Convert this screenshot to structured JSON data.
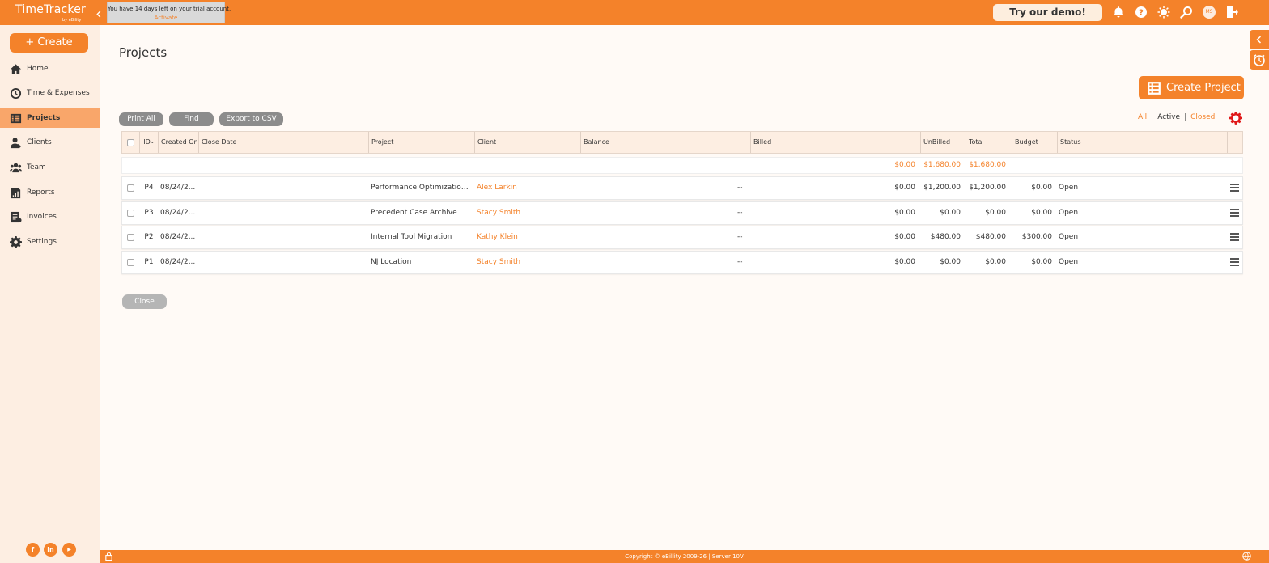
{
  "app": {
    "logo_name": "TimeTracker",
    "logo_by": "by eBility",
    "trial_message": "You have 14 days left on your trial account.",
    "trial_action": "Activate",
    "demo_button": "Try our demo!",
    "avatar_initials": "MS",
    "accent_color": "#f4822a"
  },
  "top_icons": [
    "bell-icon",
    "help-icon",
    "ai-icon",
    "search-icon",
    "avatar",
    "logout-icon"
  ],
  "sidebar": {
    "create_label": "+ Create",
    "items": [
      {
        "label": "Home",
        "icon": "home-icon"
      },
      {
        "label": "Time & Expenses",
        "icon": "clock-icon"
      },
      {
        "label": "Projects",
        "icon": "projects-icon",
        "active": true
      },
      {
        "label": "Clients",
        "icon": "clients-icon"
      },
      {
        "label": "Team",
        "icon": "team-icon"
      },
      {
        "label": "Reports",
        "icon": "reports-icon"
      },
      {
        "label": "Invoices",
        "icon": "invoices-icon"
      },
      {
        "label": "Settings",
        "icon": "gear-icon"
      }
    ],
    "social": {
      "facebook": "f",
      "linkedin": "in",
      "youtube": "▶"
    }
  },
  "main": {
    "title": "Projects",
    "create_project": "Create Project",
    "toolbar": {
      "print_all": "Print All",
      "find": "Find",
      "export_csv": "Export to CSV"
    },
    "filters": {
      "all": "All",
      "active": "Active",
      "closed": "Closed",
      "sep": "|"
    },
    "columns": {
      "id": "ID",
      "created_on": "Created On",
      "close_date": "Close Date",
      "project": "Project",
      "client": "Client",
      "balance": "Balance",
      "billed": "Billed",
      "unbilled": "UnBilled",
      "total": "Total",
      "budget": "Budget",
      "status": "Status"
    },
    "totals": {
      "billed": "$0.00",
      "unbilled": "$1,680.00",
      "total": "$1,680.00"
    },
    "rows": [
      {
        "id": "P4",
        "created_on": "08/24/2...",
        "close_date": "",
        "project": "Performance Optimization ...",
        "client": "Alex Larkin",
        "balance": "--",
        "billed": "$0.00",
        "unbilled": "$1,200.00",
        "total": "$1,200.00",
        "budget": "$0.00",
        "status": "Open"
      },
      {
        "id": "P3",
        "created_on": "08/24/2...",
        "close_date": "",
        "project": "Precedent Case Archive",
        "client": "Stacy Smith",
        "balance": "--",
        "billed": "$0.00",
        "unbilled": "$0.00",
        "total": "$0.00",
        "budget": "$0.00",
        "status": "Open"
      },
      {
        "id": "P2",
        "created_on": "08/24/2...",
        "close_date": "",
        "project": "Internal Tool Migration",
        "client": "Kathy Klein",
        "balance": "--",
        "billed": "$0.00",
        "unbilled": "$480.00",
        "total": "$480.00",
        "budget": "$300.00",
        "status": "Open"
      },
      {
        "id": "P1",
        "created_on": "08/24/2...",
        "close_date": "",
        "project": "NJ Location",
        "client": "Stacy Smith",
        "balance": "--",
        "billed": "$0.00",
        "unbilled": "$0.00",
        "total": "$0.00",
        "budget": "$0.00",
        "status": "Open"
      }
    ],
    "close_button": "Close"
  },
  "footer": {
    "text": "Copyright © eBillity 2009-26 | Server 10V"
  }
}
